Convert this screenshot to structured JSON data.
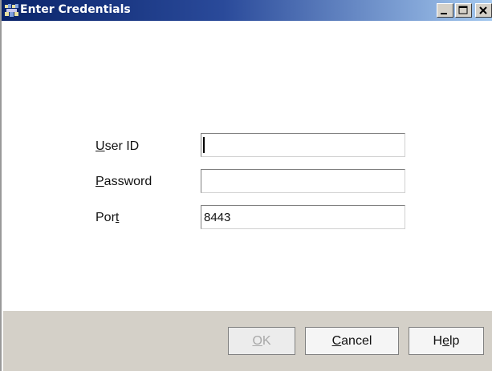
{
  "window": {
    "title": "Enter Credentials",
    "controls": {
      "minimize_icon": "minimize-icon",
      "maximize_icon": "maximize-icon",
      "close_icon": "close-icon"
    }
  },
  "form": {
    "user_id": {
      "label_mnemonic": "U",
      "label_rest": "ser ID",
      "value": ""
    },
    "password": {
      "label_mnemonic": "P",
      "label_rest": "assword",
      "value": ""
    },
    "port": {
      "label_before": "Por",
      "label_mnemonic": "t",
      "value": "8443"
    }
  },
  "buttons": {
    "ok": {
      "label_mnemonic": "O",
      "label_rest": "K",
      "enabled": false
    },
    "cancel": {
      "label_mnemonic": "C",
      "label_rest": "ancel"
    },
    "help": {
      "label_before": "H",
      "label_mnemonic": "e",
      "label_rest": "lp"
    }
  },
  "colors": {
    "titlebar_start": "#0a246a",
    "titlebar_end": "#a6caf0",
    "panel": "#d4d0c8"
  }
}
